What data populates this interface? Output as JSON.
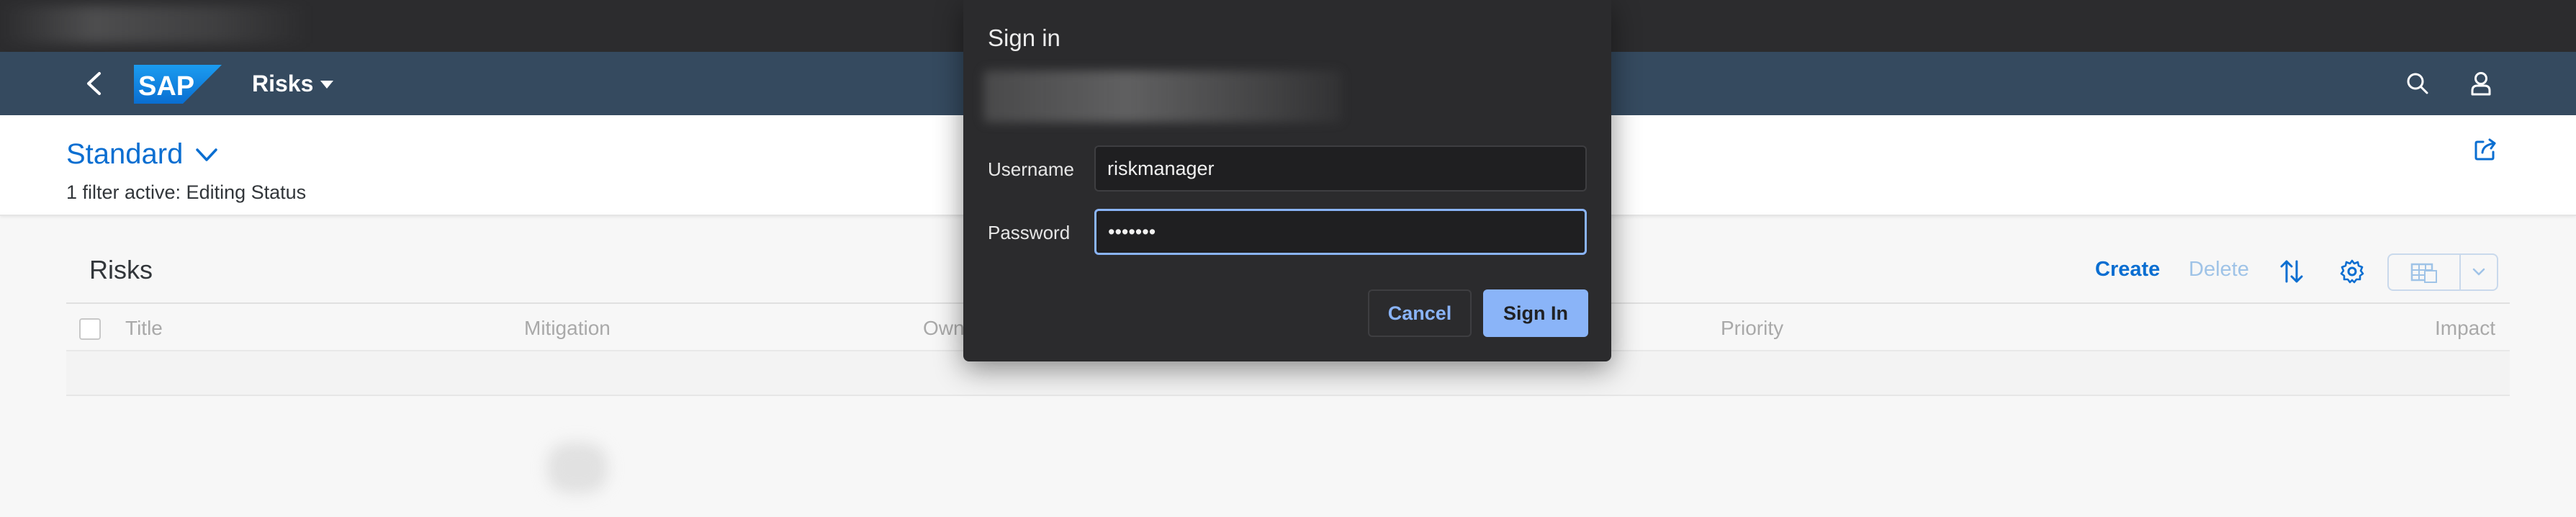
{
  "shellbar": {
    "title": "Risks",
    "logo_text": "SAP",
    "icons": [
      "back-icon",
      "search-icon",
      "user-icon"
    ]
  },
  "header": {
    "variant_label": "Standard",
    "filter_info": "1 filter active: Editing Status"
  },
  "table": {
    "title": "Risks",
    "toolbar": {
      "create_label": "Create",
      "delete_label": "Delete"
    },
    "columns": [
      "Title",
      "Mitigation",
      "Own",
      "Priority",
      "Impact"
    ]
  },
  "dialog": {
    "title": "Sign in",
    "username_label": "Username",
    "username_value": "riskmanager",
    "password_label": "Password",
    "password_value": "•••••••",
    "cancel_label": "Cancel",
    "signin_label": "Sign In"
  },
  "colors": {
    "shellbar": "#354a5f",
    "accent": "#0a6ed1",
    "dialog_bg": "#2b2b2d",
    "dialog_accent": "#8ab4f8"
  }
}
